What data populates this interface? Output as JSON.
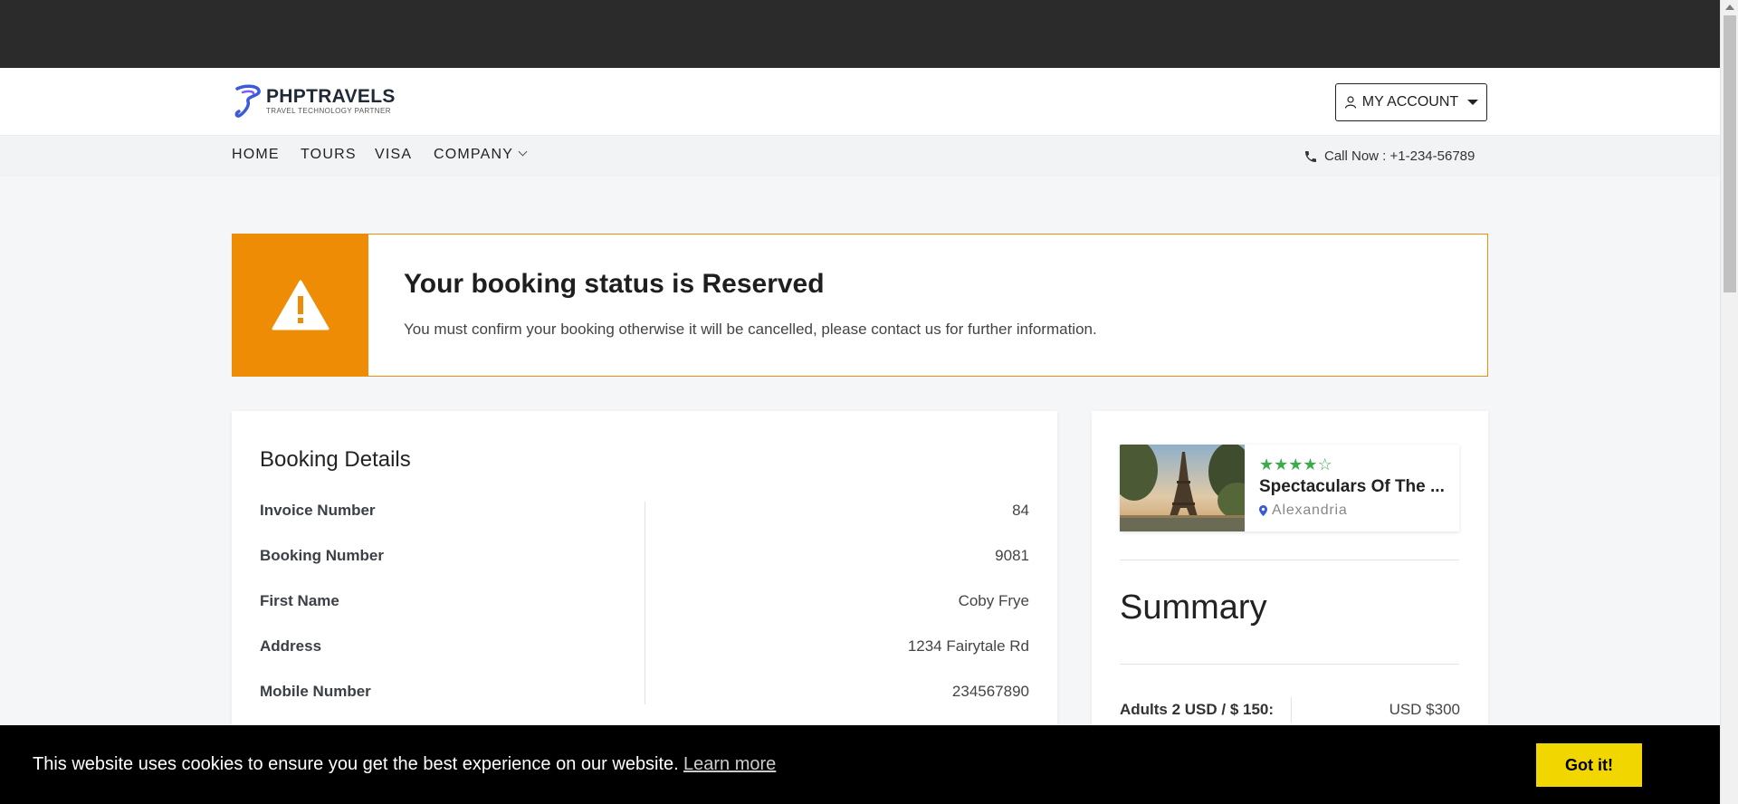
{
  "header": {
    "logo_title": "PHPTRAVELS",
    "logo_subtitle": "TRAVEL TECHNOLOGY PARTNER",
    "account_label": "MY ACCOUNT"
  },
  "nav": {
    "items": [
      "HOME",
      "TOURS",
      "VISA",
      "COMPANY"
    ],
    "call_text": "Call Now : +1-234-56789"
  },
  "alert": {
    "title": "Your booking status is Reserved",
    "message": "You must confirm your booking otherwise it will be cancelled, please contact us for further information.",
    "color": "#ee8c06"
  },
  "booking": {
    "title": "Booking Details",
    "rows": [
      {
        "label": "Invoice Number",
        "value": "84"
      },
      {
        "label": "Booking Number",
        "value": "9081"
      },
      {
        "label": "First Name",
        "value": "Coby Frye"
      },
      {
        "label": "Address",
        "value": "1234 Fairytale Rd"
      },
      {
        "label": "Mobile Number",
        "value": "234567890"
      }
    ]
  },
  "tour": {
    "rating": 4,
    "max_rating": 5,
    "name": "Spectaculars Of The ...",
    "location": "Alexandria"
  },
  "summary": {
    "title": "Summary",
    "adults_label": "Adults 2 USD / $ 150:",
    "adults_value": "USD $300"
  },
  "cookie": {
    "text": "This website uses cookies to ensure you get the best experience on our website.",
    "learn_more": "Learn more",
    "button": "Got it!"
  }
}
